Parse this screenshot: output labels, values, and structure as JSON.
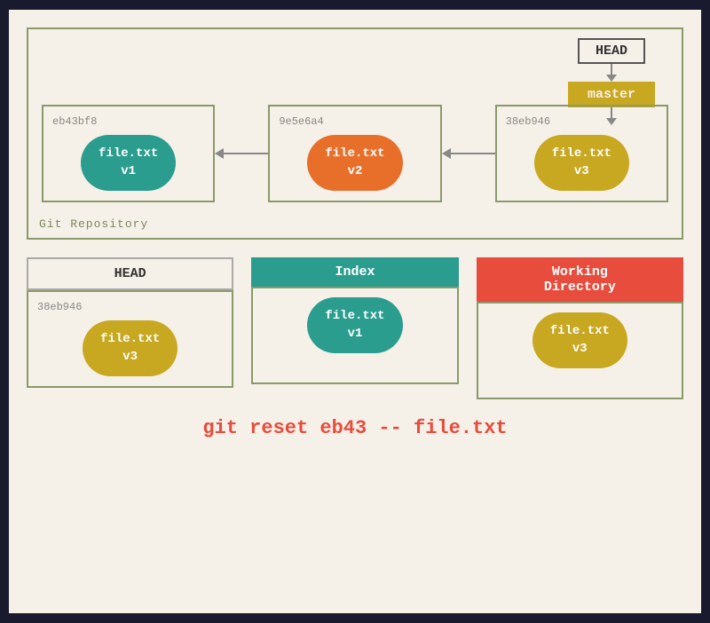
{
  "repo": {
    "label": "Git Repository",
    "head_label": "HEAD",
    "master_label": "master",
    "commits": [
      {
        "hash": "eb43bf8",
        "file_label": "file.txt\nv1",
        "color": "teal"
      },
      {
        "hash": "9e5e6a4",
        "file_label": "file.txt\nv2",
        "color": "orange"
      },
      {
        "hash": "38eb946",
        "file_label": "file.txt\nv3",
        "color": "yellow"
      }
    ]
  },
  "bottom": {
    "sections": [
      {
        "id": "head",
        "header": "HEAD",
        "header_style": "white",
        "hash": "38eb946",
        "file_label": "file.txt\nv3",
        "color": "yellow"
      },
      {
        "id": "index",
        "header": "Index",
        "header_style": "teal",
        "hash": "",
        "file_label": "file.txt\nv1",
        "color": "teal"
      },
      {
        "id": "working",
        "header": "Working\nDirectory",
        "header_style": "red",
        "hash": "",
        "file_label": "file.txt\nv3",
        "color": "yellow"
      }
    ]
  },
  "command": "git reset eb43 -- file.txt"
}
